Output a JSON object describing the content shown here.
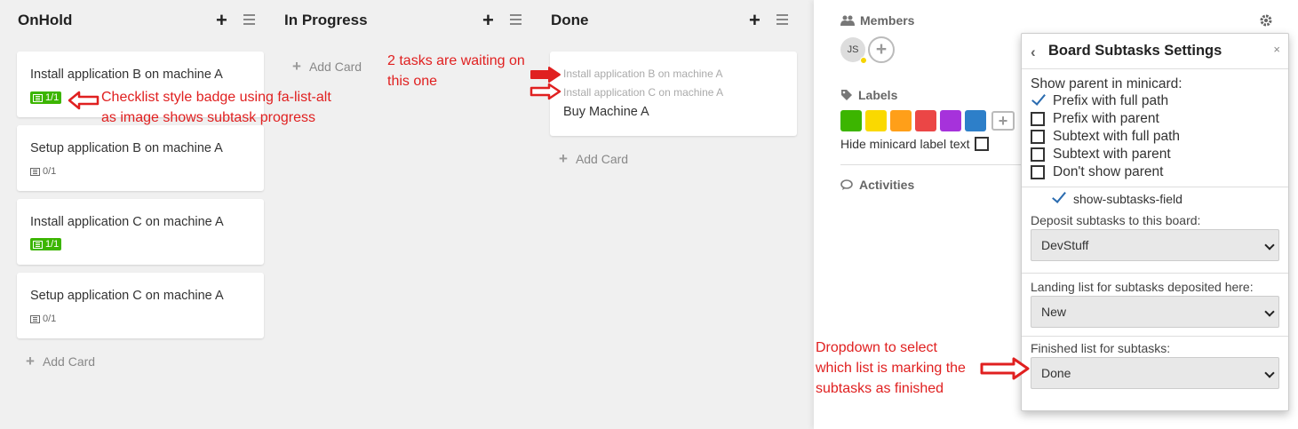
{
  "lists": [
    {
      "title": "OnHold",
      "cards": [
        {
          "title": "Install application B on machine A",
          "badge": "1/1"
        },
        {
          "title": "Setup application B on machine A",
          "badge": "0/1"
        },
        {
          "title": "Install application C on machine A",
          "badge": "1/1"
        },
        {
          "title": "Setup application C on machine A",
          "badge": "0/1"
        }
      ],
      "add_card": "Add Card"
    },
    {
      "title": "In Progress",
      "cards": [],
      "add_card": "Add Card"
    },
    {
      "title": "Done",
      "cards": [
        {
          "parents": [
            "Install application B on machine A",
            "Install application C on machine A"
          ],
          "title": "Buy Machine A"
        }
      ],
      "add_card": "Add Card"
    }
  ],
  "annotations": {
    "badge": [
      "Checklist style badge using fa-list-alt",
      "as image shows subtask progress"
    ],
    "waiting": [
      "2 tasks are waiting on",
      "this one"
    ],
    "dropdown": [
      "Dropdown to select",
      "which list is marking the",
      "subtasks as finished"
    ]
  },
  "sidebar": {
    "members_heading": "Members",
    "member_initials": "JS",
    "labels_heading": "Labels",
    "label_colors": [
      "#3cb500",
      "#fad900",
      "#ff9f19",
      "#eb4646",
      "#a632db",
      "#2d7fc9"
    ],
    "hide_label_text": "Hide minicard label text",
    "activities_heading": "Activities"
  },
  "popup": {
    "title": "Board Subtasks Settings",
    "show_parent_label": "Show parent in minicard:",
    "options": [
      {
        "label": "Prefix with full path",
        "checked": true
      },
      {
        "label": "Prefix with parent",
        "checked": false
      },
      {
        "label": "Subtext with full path",
        "checked": false
      },
      {
        "label": "Subtext with parent",
        "checked": false
      },
      {
        "label": "Don't show parent",
        "checked": false
      }
    ],
    "subtasks_field": "show-subtasks-field",
    "deposit_label": "Deposit subtasks to this board:",
    "deposit_value": "DevStuff",
    "landing_label": "Landing list for subtasks deposited here:",
    "landing_value": "New",
    "finished_label": "Finished list for subtasks:",
    "finished_value": "Done"
  }
}
